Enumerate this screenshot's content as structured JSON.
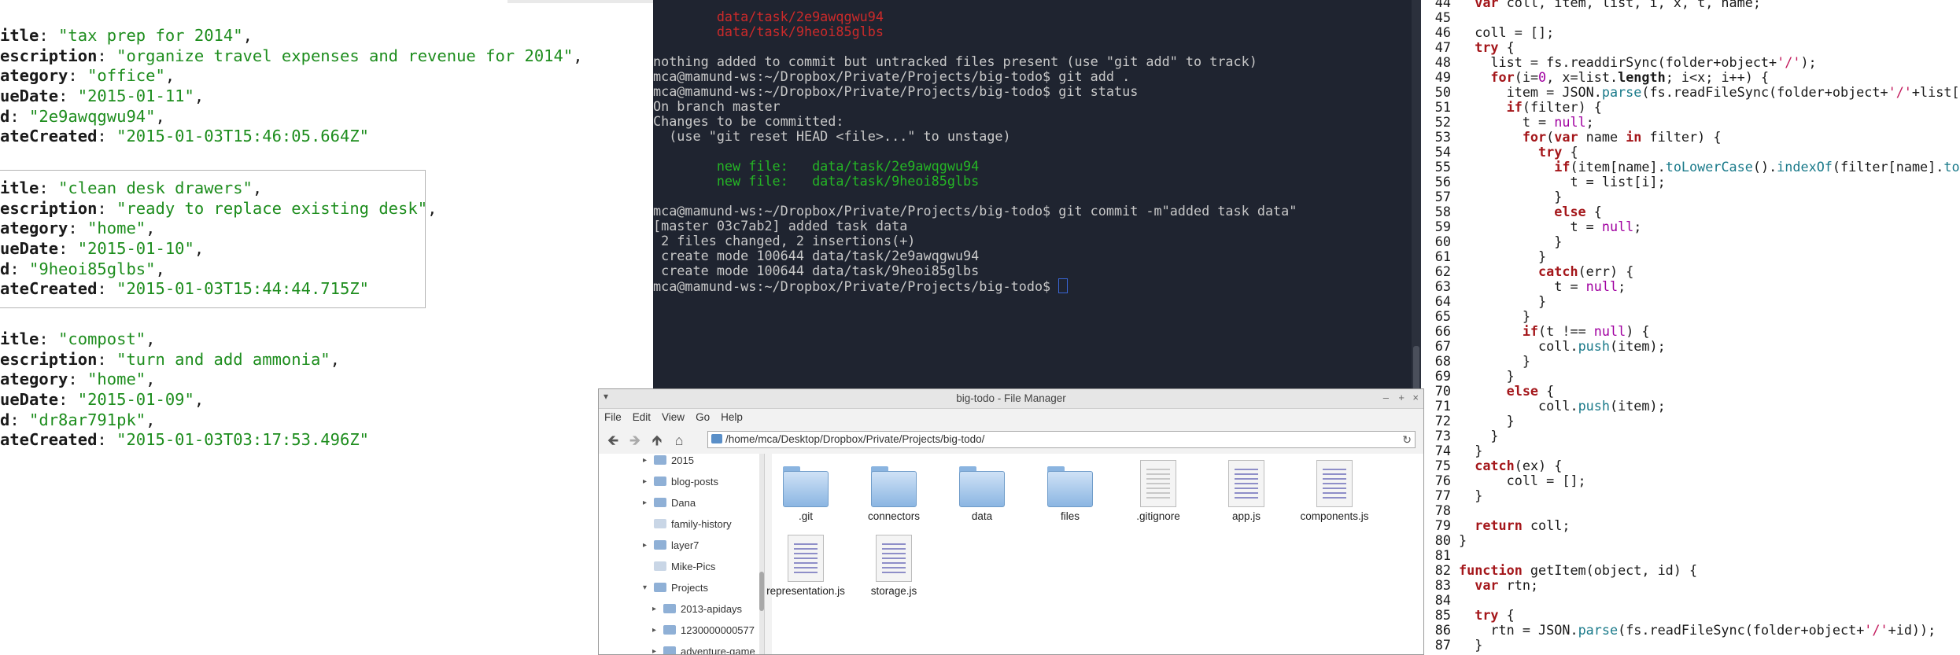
{
  "json_pane": {
    "records": [
      {
        "lines": [
          {
            "key": "itle",
            "value": "\"tax prep for 2014\"",
            "trail": ","
          },
          {
            "key": "escription",
            "value": "\"organize travel expenses and revenue for 2014\"",
            "trail": ","
          },
          {
            "key": "ategory",
            "value": "\"office\"",
            "trail": ","
          },
          {
            "key": "ueDate",
            "value": "\"2015-01-11\"",
            "trail": ","
          },
          {
            "key": "d",
            "value": "\"2e9awqgwu94\"",
            "trail": ","
          },
          {
            "key": "ateCreated",
            "value": "\"2015-01-03T15:46:05.664Z\"",
            "trail": ""
          }
        ]
      },
      {
        "lines": [
          {
            "key": "itle",
            "value": "\"clean desk drawers\"",
            "trail": ","
          },
          {
            "key": "escription",
            "value": "\"ready to replace existing desk\"",
            "trail": ","
          },
          {
            "key": "ategory",
            "value": "\"home\"",
            "trail": ","
          },
          {
            "key": "ueDate",
            "value": "\"2015-01-10\"",
            "trail": ","
          },
          {
            "key": "d",
            "value": "\"9heoi85glbs\"",
            "trail": ","
          },
          {
            "key": "ateCreated",
            "value": "\"2015-01-03T15:44:44.715Z\"",
            "trail": ""
          }
        ]
      },
      {
        "lines": [
          {
            "key": "itle",
            "value": "\"compost\"",
            "trail": ","
          },
          {
            "key": "escription",
            "value": "\"turn and add ammonia\"",
            "trail": ","
          },
          {
            "key": "ategory",
            "value": "\"home\"",
            "trail": ","
          },
          {
            "key": "ueDate",
            "value": "\"2015-01-09\"",
            "trail": ","
          },
          {
            "key": "d",
            "value": "\"dr8ar791pk\"",
            "trail": ","
          },
          {
            "key": "ateCreated",
            "value": "\"2015-01-03T03:17:53.496Z\"",
            "trail": ""
          }
        ]
      }
    ]
  },
  "terminal": {
    "lines": [
      {
        "text": "        data/task/2e9awqgwu94",
        "color": "red"
      },
      {
        "text": "        data/task/9heoi85glbs",
        "color": "red"
      },
      {
        "text": "",
        "color": "default"
      },
      {
        "text": "nothing added to commit but untracked files present (use \"git add\" to track)",
        "color": "default"
      },
      {
        "text": "mca@mamund-ws:~/Dropbox/Private/Projects/big-todo$ git add .",
        "color": "default"
      },
      {
        "text": "mca@mamund-ws:~/Dropbox/Private/Projects/big-todo$ git status",
        "color": "default"
      },
      {
        "text": "On branch master",
        "color": "default"
      },
      {
        "text": "Changes to be committed:",
        "color": "default"
      },
      {
        "text": "  (use \"git reset HEAD <file>...\" to unstage)",
        "color": "default"
      },
      {
        "text": "",
        "color": "default"
      },
      {
        "text": "        new file:   data/task/2e9awqgwu94",
        "color": "green"
      },
      {
        "text": "        new file:   data/task/9heoi85glbs",
        "color": "green"
      },
      {
        "text": "",
        "color": "default"
      },
      {
        "text": "mca@mamund-ws:~/Dropbox/Private/Projects/big-todo$ git commit -m\"added task data\"",
        "color": "default"
      },
      {
        "text": "[master 03c7ab2] added task data",
        "color": "default"
      },
      {
        "text": " 2 files changed, 2 insertions(+)",
        "color": "default"
      },
      {
        "text": " create mode 100644 data/task/2e9awqgwu94",
        "color": "default"
      },
      {
        "text": " create mode 100644 data/task/9heoi85glbs",
        "color": "default"
      },
      {
        "text": "mca@mamund-ws:~/Dropbox/Private/Projects/big-todo$ ",
        "color": "default",
        "cursor": true
      }
    ]
  },
  "editor": {
    "lines": [
      {
        "n": "44",
        "segs": [
          [
            "",
            "  "
          ],
          [
            "kw",
            "var"
          ],
          [
            "",
            " coll, item, list, i, x, t, name;"
          ]
        ]
      },
      {
        "n": "45",
        "segs": [
          [
            "",
            ""
          ]
        ]
      },
      {
        "n": "46",
        "segs": [
          [
            "",
            "  coll = [];"
          ]
        ]
      },
      {
        "n": "47",
        "segs": [
          [
            "",
            "  "
          ],
          [
            "kw",
            "try"
          ],
          [
            "",
            " {"
          ]
        ]
      },
      {
        "n": "48",
        "segs": [
          [
            "",
            "    list = fs.readdirSync(folder+object+"
          ],
          [
            "str",
            "'/'"
          ],
          [
            "",
            ");"
          ]
        ]
      },
      {
        "n": "49",
        "segs": [
          [
            "",
            "    "
          ],
          [
            "kw",
            "for"
          ],
          [
            "",
            "(i="
          ],
          [
            "num",
            "0"
          ],
          [
            "",
            ", x=list."
          ],
          [
            "prop",
            "length"
          ],
          [
            "",
            "; i<x; i++) {"
          ]
        ]
      },
      {
        "n": "50",
        "segs": [
          [
            "",
            "      item = JSON."
          ],
          [
            "fn",
            "parse"
          ],
          [
            "",
            "(fs.readFileSync(folder+object+"
          ],
          [
            "str",
            "'/'"
          ],
          [
            "",
            "+list[i"
          ]
        ]
      },
      {
        "n": "51",
        "segs": [
          [
            "",
            "      "
          ],
          [
            "kw",
            "if"
          ],
          [
            "",
            "(filter) {"
          ]
        ]
      },
      {
        "n": "52",
        "segs": [
          [
            "",
            "        t = "
          ],
          [
            "num",
            "null"
          ],
          [
            "",
            ";"
          ]
        ]
      },
      {
        "n": "53",
        "segs": [
          [
            "",
            "        "
          ],
          [
            "kw",
            "for"
          ],
          [
            "",
            "("
          ],
          [
            "kw",
            "var"
          ],
          [
            "",
            " name "
          ],
          [
            "kw",
            "in"
          ],
          [
            "",
            " filter) {"
          ]
        ]
      },
      {
        "n": "54",
        "segs": [
          [
            "",
            "          "
          ],
          [
            "kw",
            "try"
          ],
          [
            "",
            " {"
          ]
        ]
      },
      {
        "n": "55",
        "segs": [
          [
            "",
            "            "
          ],
          [
            "kw",
            "if"
          ],
          [
            "",
            "(item[name]."
          ],
          [
            "fn",
            "toLowerCase"
          ],
          [
            "",
            "()."
          ],
          [
            "fn",
            "indexOf"
          ],
          [
            "",
            "(filter[name]."
          ],
          [
            "fn",
            "toLo"
          ]
        ]
      },
      {
        "n": "56",
        "segs": [
          [
            "",
            "              t = list[i];"
          ]
        ]
      },
      {
        "n": "57",
        "segs": [
          [
            "",
            "            }"
          ]
        ]
      },
      {
        "n": "58",
        "segs": [
          [
            "",
            "            "
          ],
          [
            "kw",
            "else"
          ],
          [
            "",
            " {"
          ]
        ]
      },
      {
        "n": "59",
        "segs": [
          [
            "",
            "              t = "
          ],
          [
            "num",
            "null"
          ],
          [
            "",
            ";"
          ]
        ]
      },
      {
        "n": "60",
        "segs": [
          [
            "",
            "            }"
          ]
        ]
      },
      {
        "n": "61",
        "segs": [
          [
            "",
            "          }"
          ]
        ]
      },
      {
        "n": "62",
        "segs": [
          [
            "",
            "          "
          ],
          [
            "kw",
            "catch"
          ],
          [
            "",
            "(err) {"
          ]
        ]
      },
      {
        "n": "63",
        "segs": [
          [
            "",
            "            t = "
          ],
          [
            "num",
            "null"
          ],
          [
            "",
            ";"
          ]
        ]
      },
      {
        "n": "64",
        "segs": [
          [
            "",
            "          }"
          ]
        ]
      },
      {
        "n": "65",
        "segs": [
          [
            "",
            "        }"
          ]
        ]
      },
      {
        "n": "66",
        "segs": [
          [
            "",
            "        "
          ],
          [
            "kw",
            "if"
          ],
          [
            "",
            "(t !== "
          ],
          [
            "num",
            "null"
          ],
          [
            "",
            ") {"
          ]
        ]
      },
      {
        "n": "67",
        "segs": [
          [
            "",
            "          coll."
          ],
          [
            "fn",
            "push"
          ],
          [
            "",
            "(item);"
          ]
        ]
      },
      {
        "n": "68",
        "segs": [
          [
            "",
            "        }"
          ]
        ]
      },
      {
        "n": "69",
        "segs": [
          [
            "",
            "      }"
          ]
        ]
      },
      {
        "n": "70",
        "segs": [
          [
            "",
            "      "
          ],
          [
            "kw",
            "else"
          ],
          [
            "",
            " {"
          ]
        ]
      },
      {
        "n": "71",
        "segs": [
          [
            "",
            "          coll."
          ],
          [
            "fn",
            "push"
          ],
          [
            "",
            "(item);"
          ]
        ]
      },
      {
        "n": "72",
        "segs": [
          [
            "",
            "      }"
          ]
        ]
      },
      {
        "n": "73",
        "segs": [
          [
            "",
            "    }"
          ]
        ]
      },
      {
        "n": "74",
        "segs": [
          [
            "",
            "  }"
          ]
        ]
      },
      {
        "n": "75",
        "segs": [
          [
            "",
            "  "
          ],
          [
            "kw",
            "catch"
          ],
          [
            "",
            "(ex) {"
          ]
        ]
      },
      {
        "n": "76",
        "segs": [
          [
            "",
            "      coll = [];"
          ]
        ]
      },
      {
        "n": "77",
        "segs": [
          [
            "",
            "  }"
          ]
        ]
      },
      {
        "n": "78",
        "segs": [
          [
            "",
            ""
          ]
        ]
      },
      {
        "n": "79",
        "segs": [
          [
            "",
            "  "
          ],
          [
            "kw",
            "return"
          ],
          [
            "",
            " coll;"
          ]
        ]
      },
      {
        "n": "80",
        "segs": [
          [
            "",
            "}"
          ]
        ]
      },
      {
        "n": "81",
        "segs": [
          [
            "",
            ""
          ]
        ]
      },
      {
        "n": "82",
        "segs": [
          [
            "kw",
            "function"
          ],
          [
            "",
            " getItem(object, id) {"
          ]
        ]
      },
      {
        "n": "83",
        "segs": [
          [
            "",
            "  "
          ],
          [
            "kw",
            "var"
          ],
          [
            "",
            " rtn;"
          ]
        ]
      },
      {
        "n": "84",
        "segs": [
          [
            "",
            ""
          ]
        ]
      },
      {
        "n": "85",
        "segs": [
          [
            "",
            "  "
          ],
          [
            "kw",
            "try"
          ],
          [
            "",
            " {"
          ]
        ]
      },
      {
        "n": "86",
        "segs": [
          [
            "",
            "    rtn = JSON."
          ],
          [
            "fn",
            "parse"
          ],
          [
            "",
            "(fs.readFileSync(folder+object+"
          ],
          [
            "str",
            "'/'"
          ],
          [
            "",
            "+id));"
          ]
        ]
      },
      {
        "n": "87",
        "segs": [
          [
            "",
            "  }"
          ]
        ]
      }
    ]
  },
  "file_manager": {
    "title": "big-todo - File Manager",
    "menu": [
      "File",
      "Edit",
      "View",
      "Go",
      "Help"
    ],
    "path": "/home/mca/Desktop/Dropbox/Private/Projects/big-todo/",
    "nav_icons": [
      "back-arrow-icon",
      "forward-arrow-icon",
      "up-arrow-icon",
      "home-icon"
    ],
    "sidebar": [
      {
        "label": "2015",
        "expander": true,
        "level": 0
      },
      {
        "label": "blog-posts",
        "expander": true,
        "level": 0
      },
      {
        "label": "Dana",
        "expander": true,
        "level": 0
      },
      {
        "label": "family-history",
        "expander": false,
        "level": 0
      },
      {
        "label": "layer7",
        "expander": true,
        "level": 0
      },
      {
        "label": "Mike-Pics",
        "expander": false,
        "level": 0
      },
      {
        "label": "Projects",
        "expander": true,
        "expanded": true,
        "level": 0
      },
      {
        "label": "2013-apidays",
        "expander": true,
        "level": 1
      },
      {
        "label": "1230000000577",
        "expander": true,
        "level": 1
      },
      {
        "label": "adventure-game",
        "expander": true,
        "level": 1
      }
    ],
    "files": [
      {
        "name": ".git",
        "kind": "folder"
      },
      {
        "name": "connectors",
        "kind": "folder"
      },
      {
        "name": "data",
        "kind": "folder"
      },
      {
        "name": "files",
        "kind": "folder"
      },
      {
        "name": ".gitignore",
        "kind": "text"
      },
      {
        "name": "app.js",
        "kind": "code"
      },
      {
        "name": "components.js",
        "kind": "code"
      },
      {
        "name": "representation.js",
        "kind": "code"
      },
      {
        "name": "storage.js",
        "kind": "code"
      }
    ]
  }
}
